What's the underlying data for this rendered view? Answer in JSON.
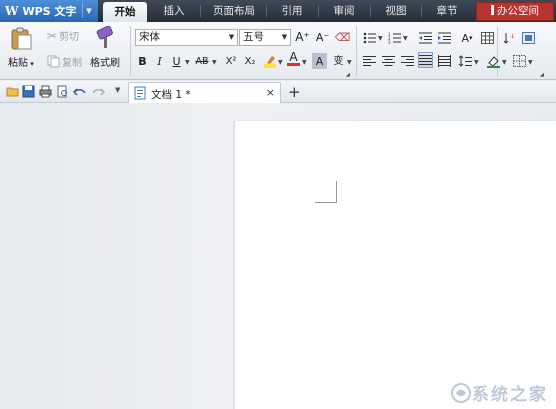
{
  "app": {
    "name": "WPS 文字",
    "logo_letter": "W"
  },
  "menu": {
    "tabs": [
      {
        "label": "开始",
        "active": true
      },
      {
        "label": "插入"
      },
      {
        "label": "页面布局"
      },
      {
        "label": "引用"
      },
      {
        "label": "审阅"
      },
      {
        "label": "视图"
      },
      {
        "label": "章节"
      },
      {
        "label": "办公空间"
      }
    ]
  },
  "ribbon": {
    "paste_label": "粘贴",
    "cut_label": "剪切",
    "copy_label": "复制",
    "format_painter_label": "格式刷",
    "font_name": "宋体",
    "font_size": "五号",
    "bold": "B",
    "italic": "I",
    "underline": "U",
    "strikethrough": "AB",
    "superscript": "X²",
    "subscript": "X₂",
    "grow_font": "A⁺",
    "shrink_font": "A⁻",
    "font_color_letter": "A",
    "char_shading_letter": "A",
    "pinyin_label": "变"
  },
  "quickbar": {
    "document_tab": {
      "title": "文档 1 *"
    },
    "close_symbol": "×",
    "new_tab_symbol": "+"
  },
  "watermark": {
    "text": "系统之家"
  },
  "colors": {
    "accent_blue": "#2a66b3",
    "menubar_dark": "#262d37",
    "office_red": "#b5342f",
    "highlight_yellow": "#f5e642",
    "font_red": "#d8302b"
  }
}
